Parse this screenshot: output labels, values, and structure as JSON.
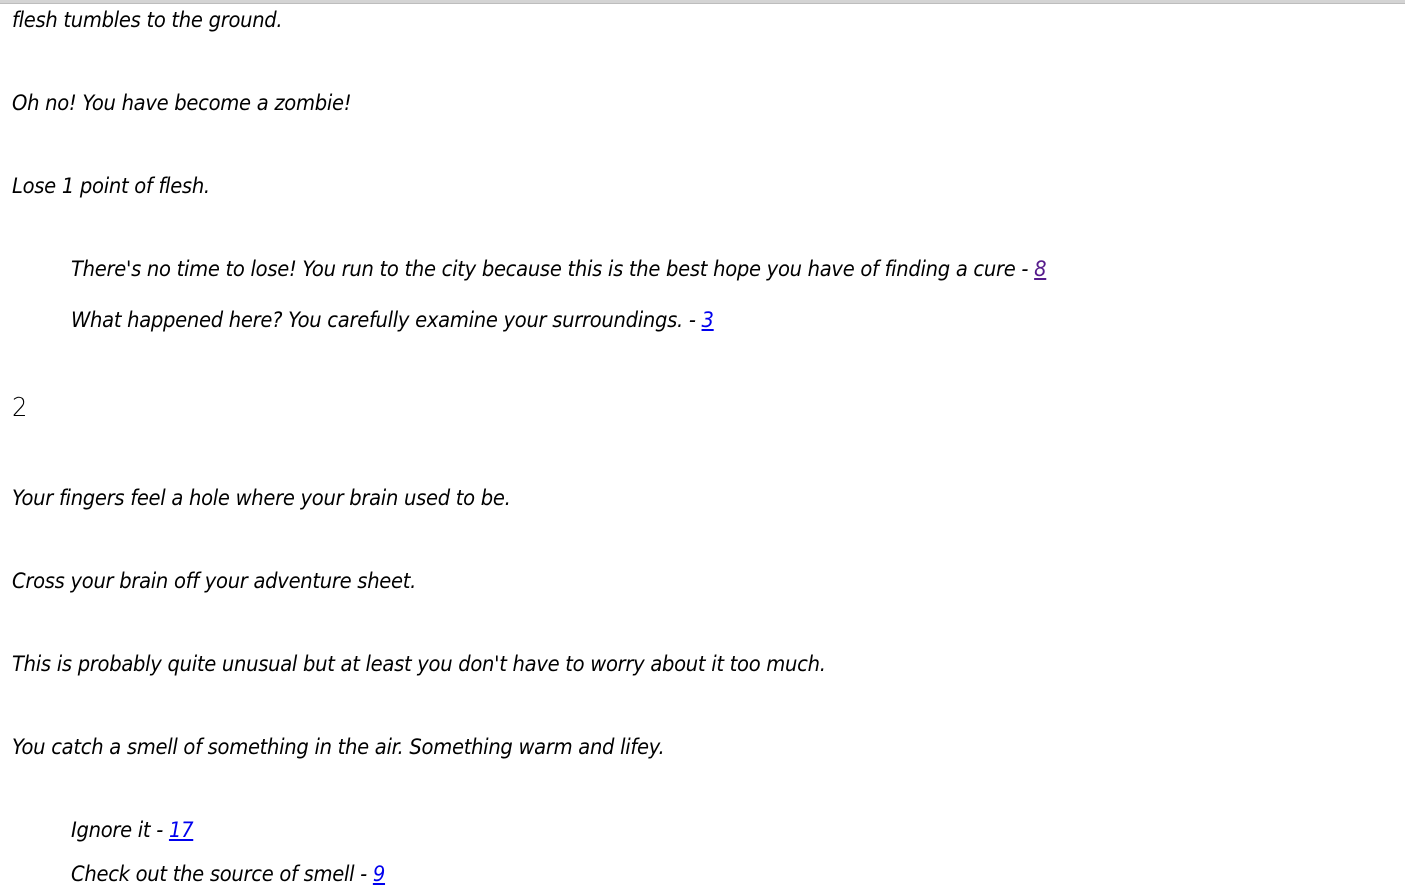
{
  "colors": {
    "link": "#0000ee",
    "visited_link": "#551a8b",
    "text": "#000000"
  },
  "sections": [
    {
      "paragraphs": [
        "flesh tumbles to the ground.",
        "Oh no! You have become a zombie!",
        "Lose 1 point of flesh."
      ],
      "choices": [
        {
          "text": "There's no time to lose! You run to the city because this is the best hope you have of finding a cure - ",
          "link": "8",
          "visited": true
        },
        {
          "text": "What happened here? You carefully examine your surroundings. - ",
          "link": "3",
          "visited": false
        }
      ]
    },
    {
      "heading": "2",
      "paragraphs": [
        "Your fingers feel a hole where your brain used to be.",
        "Cross your brain off your adventure sheet.",
        "This is probably quite unusual but at least you don't have to worry about it too much.",
        "You catch a smell of something in the air. Something warm and lifey."
      ],
      "choices": [
        {
          "text": "Ignore it - ",
          "link": "17",
          "visited": false
        },
        {
          "text": "Check out the source of smell - ",
          "link": "9",
          "visited": false
        }
      ]
    }
  ]
}
